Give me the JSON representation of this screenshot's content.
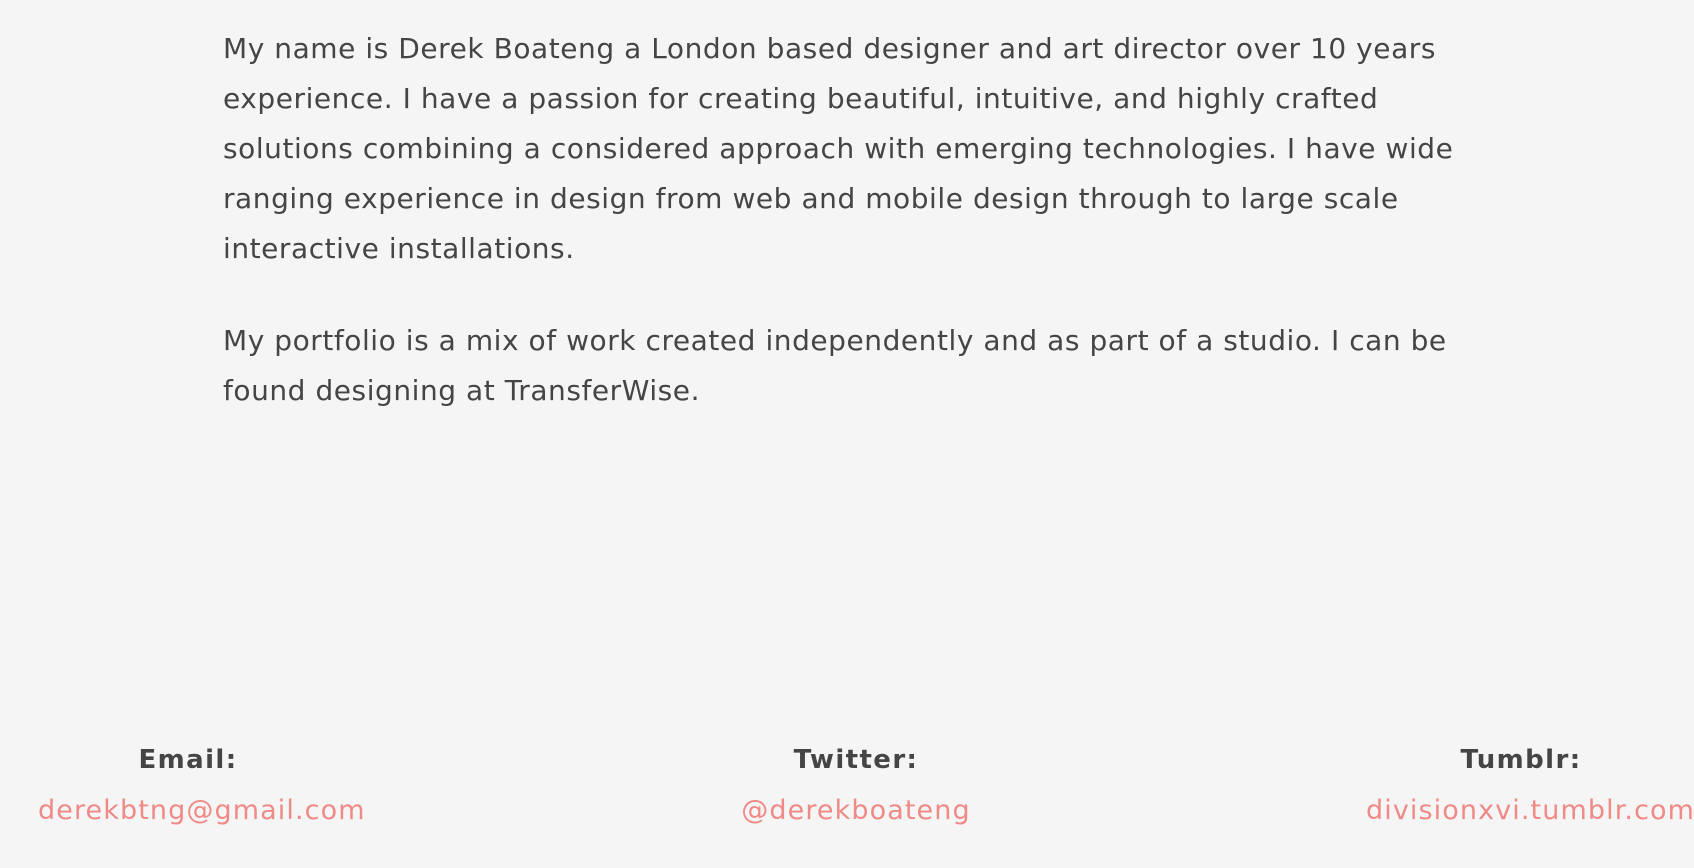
{
  "bio": {
    "paragraph_1": "My name is Derek Boateng a London based designer and art director over 10 years experience. I have a passion for creating beautiful, intuitive, and highly crafted solutions combining a considered approach with emerging technologies. I have wide ranging experience in design from web and mobile design through to large scale interactive installations.",
    "paragraph_2": "My portfolio is a mix of work created independently and as part of a studio. I can be found designing at TransferWise."
  },
  "contacts": {
    "email": {
      "label": "Email:",
      "value": "derekbtng@gmail.com"
    },
    "twitter": {
      "label": "Twitter:",
      "value": "@derekboateng"
    },
    "tumblr": {
      "label": "Tumblr:",
      "value": "divisionxvi.tumblr.com"
    }
  },
  "colors": {
    "background": "#f5f5f5",
    "text": "#454545",
    "link": "#ef8a87"
  }
}
